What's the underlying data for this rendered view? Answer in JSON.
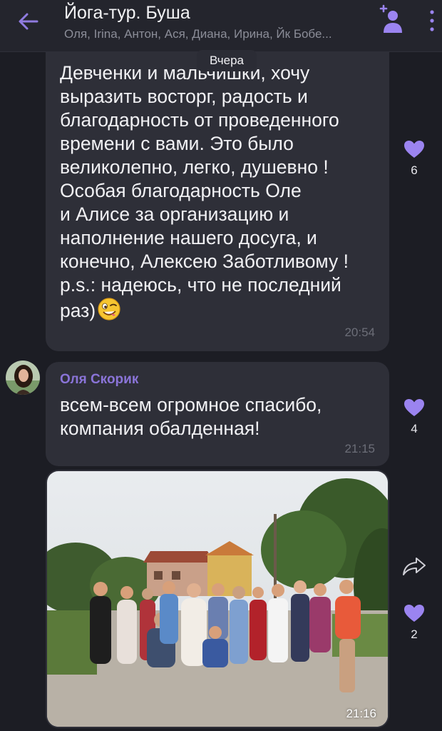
{
  "header": {
    "title": "Йога-тур. Буша",
    "members": "Оля, Irina, Антон, Ася, Диана, Ирина, Йк Бобе..."
  },
  "date_divider": "Вчера",
  "messages": [
    {
      "text": "Девченки и мальчишки, хочу\nвыразить восторг, радость и\nблагодарность от проведенного\nвремени с вами.  Это было\nвеликолепно, легко, душевно !\nОсобая благодарность Оле\nи Алисе за организацию и\nнаполнение нашего досуга, и\nконечно, Алексею Заботливому !\np.s.:  надеюсь, что не последний\nраз)",
      "time": "20:54",
      "likes": "6"
    },
    {
      "sender": "Оля Скорик",
      "text": "всем-всем огромное спасибо,\nкомпания обалденная!",
      "time": "21:15",
      "likes": "4"
    },
    {
      "type": "photo",
      "time": "21:16",
      "likes": "2"
    }
  ],
  "icons": {
    "back": "arrow-left-icon",
    "add_member": "add-member-icon",
    "more": "more-vertical-icon",
    "like": "heart-icon",
    "share": "share-icon",
    "emoji": "winking-face-emoji"
  },
  "colors": {
    "accent": "#8a74d8",
    "heart": "#9b84f0",
    "background": "#1c1d24",
    "bubble": "#2e2f38"
  }
}
